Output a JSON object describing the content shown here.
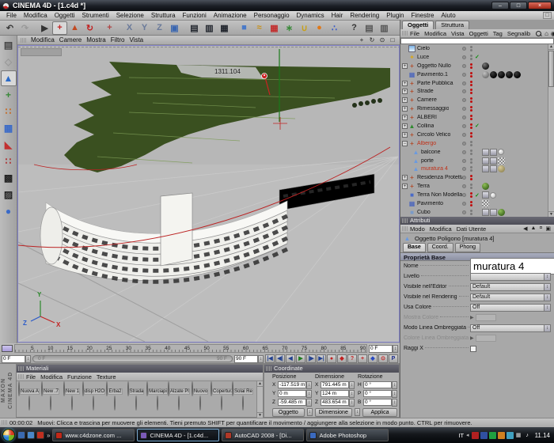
{
  "window": {
    "title": "CINEMA 4D - [1.c4d *]",
    "minimize": "–",
    "restore": "□",
    "close": "×",
    "mdi_restore": "□"
  },
  "menu_bar": {
    "items": [
      "File",
      "Modifica",
      "Oggetti",
      "Strumenti",
      "Selezione",
      "Struttura",
      "Funzioni",
      "Animazione",
      "Personaggio",
      "Dynamics",
      "Hair",
      "Rendering",
      "Plugin",
      "Finestre",
      "Aiuto"
    ]
  },
  "toolbar": {
    "icons": [
      {
        "name": "undo-icon",
        "g": "↶",
        "c": "#3a3a3a"
      },
      {
        "name": "redo-icon",
        "g": "↷",
        "c": "#9a9a9a"
      },
      {
        "name": "live-selection-icon",
        "g": "▶",
        "c": "#333333",
        "cls": "gap"
      },
      {
        "name": "move-tool-icon",
        "g": "+",
        "c": "#c22222",
        "cls": "active"
      },
      {
        "name": "scale-tool-icon",
        "g": "▲",
        "c": "#c24a22"
      },
      {
        "name": "rotate-tool-icon",
        "g": "↻",
        "c": "#c22222"
      },
      {
        "name": "last-tool-icon",
        "g": "+",
        "c": "#b04444",
        "cls": "gap"
      },
      {
        "name": "lock-x-axis-icon",
        "g": "X",
        "c": "#6a7a9a",
        "cls": "gap"
      },
      {
        "name": "lock-y-axis-icon",
        "g": "Y",
        "c": "#6a7a9a"
      },
      {
        "name": "lock-z-axis-icon",
        "g": "Z",
        "c": "#6a7a9a"
      },
      {
        "name": "coordinate-system-icon",
        "g": "▣",
        "c": "#3a66b0"
      },
      {
        "name": "render-view-icon",
        "g": "▤",
        "c": "#22262e",
        "cls": "gap"
      },
      {
        "name": "render-region-icon",
        "g": "▥",
        "c": "#22262e"
      },
      {
        "name": "render-settings-icon",
        "g": "▦",
        "c": "#22262e"
      },
      {
        "name": "add-cube-icon",
        "g": "■",
        "c": "#4a7ac8",
        "cls": "gap"
      },
      {
        "name": "add-spline-icon",
        "g": "≈",
        "c": "#c89018"
      },
      {
        "name": "add-deformer-icon",
        "g": "▦",
        "c": "#c23030"
      },
      {
        "name": "add-array-icon",
        "g": "∗",
        "c": "#3a8a3a"
      },
      {
        "name": "add-boole-icon",
        "g": "∪",
        "c": "#c8a018"
      },
      {
        "name": "add-sphere-icon",
        "g": "●",
        "c": "#e07818"
      },
      {
        "name": "add-particles-icon",
        "g": "∴",
        "c": "#3a5ac8"
      },
      {
        "name": "help-cursor-icon",
        "g": "?",
        "c": "#333333",
        "cls": "gap"
      },
      {
        "name": "display-layout-icon",
        "g": "▤",
        "c": "#555555"
      },
      {
        "name": "display-layout-2-icon",
        "g": "▥",
        "c": "#555555"
      }
    ]
  },
  "left_toolbar": {
    "icons": [
      {
        "name": "layout-switch-icon",
        "g": "▤",
        "c": "#444444"
      },
      {
        "name": "convert-object-icon",
        "g": "◇",
        "c": "#999999"
      },
      {
        "name": "model-mode-icon",
        "g": "▲",
        "c": "#2a6ac8",
        "cls": "active"
      },
      {
        "name": "object-axis-mode-icon",
        "g": "+",
        "c": "#3a8a3a"
      },
      {
        "name": "point-mode-icon",
        "g": "∷",
        "c": "#c86820"
      },
      {
        "name": "edge-mode-icon",
        "g": "▦",
        "c": "#3a6ac8"
      },
      {
        "name": "polygon-mode-icon",
        "g": "◣",
        "c": "#c23030"
      },
      {
        "name": "animation-mode-icon",
        "g": "∷",
        "c": "#b03030"
      },
      {
        "name": "texture-mode-icon",
        "g": "▩",
        "c": "#222222"
      },
      {
        "name": "texture-axis-mode-icon",
        "g": "▨",
        "c": "#222222"
      },
      {
        "name": "object-mode-icon",
        "g": "●",
        "c": "#3a6ac8"
      }
    ]
  },
  "viewport": {
    "menu": [
      "Modifica",
      "Camere",
      "Mostra",
      "Filtro",
      "Vista"
    ],
    "nav": [
      {
        "name": "pan-view-icon",
        "g": "+"
      },
      {
        "name": "rotate-view-icon",
        "g": "↻"
      },
      {
        "name": "zoom-view-icon",
        "g": "⊙"
      },
      {
        "name": "toggle-view-icon",
        "g": "□"
      }
    ],
    "measure_label": "1311.104",
    "axis": {
      "x": "X",
      "y": "Y",
      "z": "Z"
    }
  },
  "timeline": {
    "ticks": [
      "5",
      "10",
      "15",
      "20",
      "25",
      "30",
      "35",
      "40",
      "45",
      "50",
      "55",
      "60",
      "65",
      "70",
      "75",
      "80",
      "85",
      "90"
    ],
    "top_right_field": "0 F",
    "frame_field": "0 F",
    "range_start_label": "0 F",
    "range_end_label": "90 F",
    "range_end_field": "90 F",
    "transport": [
      {
        "name": "goto-start-button",
        "g": "|◀",
        "c": "#23418f"
      },
      {
        "name": "previous-frame-button",
        "g": "◀|",
        "c": "#23418f"
      },
      {
        "name": "play-backward-button",
        "g": "◀",
        "c": "#23418f"
      },
      {
        "name": "play-button",
        "g": "▶",
        "c": "#1f7a1f"
      },
      {
        "name": "next-frame-button",
        "g": "|▶",
        "c": "#23418f"
      },
      {
        "name": "goto-end-button",
        "g": "▶|",
        "c": "#23418f"
      },
      {
        "name": "record-button",
        "g": "●",
        "c": "#c22020"
      },
      {
        "name": "record-key-button",
        "g": "◆",
        "c": "#c22020"
      },
      {
        "name": "autokey-button",
        "g": "?",
        "c": "#c22020"
      },
      {
        "name": "add-key-button",
        "g": "+",
        "c": "#c22020"
      },
      {
        "name": "key-tool-button",
        "g": "◆",
        "c": "#2a4ac0"
      },
      {
        "name": "time-settings-button",
        "g": "⊙",
        "c": "#c22020"
      },
      {
        "name": "powerslider-button",
        "g": "P",
        "c": "#1a2a8a"
      }
    ]
  },
  "materials": {
    "title": "Materiali",
    "menu": [
      "File",
      "Modifica",
      "Funzione",
      "Texture"
    ],
    "row1": [
      {
        "name": "Nuova A",
        "bg": "radial-gradient(circle at 35% 30%,#d8ecf8,#5a8cc0 45%,#2f4f33 85%)"
      },
      {
        "name": "New .7",
        "bg": "radial-gradient(circle at 35% 30%,#3a3a3a,#000 70%)"
      },
      {
        "name": "New 1",
        "bg": "radial-gradient(circle at 35% 30%,#2e2e2e,#000 70%)"
      },
      {
        "name": "disp H2O",
        "bg": "radial-gradient(circle at 35% 30%,#303038,#000 70%)"
      },
      {
        "name": "Erba2",
        "bg": "radial-gradient(circle at 35% 30%,#9cc455,#43611c 75%)"
      },
      {
        "name": "Strada",
        "bg": "radial-gradient(circle at 35% 30%,#b0b0b0,#5e5e5e 75%)"
      },
      {
        "name": "Marciapi",
        "bg": "radial-gradient(circle at 35% 30%,#b2b4a4,#686a5c 75%)"
      },
      {
        "name": "Alzate Pl",
        "bg": "radial-gradient(circle at 35% 30%,#dededa,#96968e 75%)"
      },
      {
        "name": "Nuovo",
        "bg": "radial-gradient(circle at 35% 30%,#ececea,#aaaaa4 75%)"
      },
      {
        "name": "Copertur.",
        "bg": "repeating-linear-gradient(135deg,#c2c2ca 0 2px,#7e7e88 2px 4px)"
      },
      {
        "name": "Solai Re",
        "bg": "radial-gradient(circle at 35% 30%,#d6d6d2,#8e8e86 75%)"
      }
    ],
    "row2": [
      {
        "bg": "repeating-linear-gradient(45deg,#9a9a9a 0 2px,#555 2px 4px)"
      },
      {
        "bg": "radial-gradient(circle at 35% 30%,#fff,#9ab0c0 50%,#5a6a78)"
      },
      {
        "bg": "radial-gradient(circle at 35% 30%,#e2d27a,#a08a22 75%)"
      },
      {
        "bg": "radial-gradient(circle at 35% 30%,#b0a878,#66663e 75%)"
      },
      {
        "bg": "repeating-linear-gradient(135deg,#aaa 0 2px,#777 2px 4px)"
      },
      {
        "bg": "radial-gradient(circle at 35% 30%,#6a4a32,#2c1a10 75%)"
      },
      {
        "bg": "radial-gradient(circle at 35% 30%,#8a9a50,#47561f 75%)"
      },
      {
        "bg": "radial-gradient(circle at 35% 30%,#3a3a3a,#0a0a0a 75%)"
      },
      {
        "bg": "radial-gradient(circle at 35% 30%,#9ac060,#4a7a20 75%)"
      },
      {
        "bg": "radial-gradient(circle at 35% 30%,#b8b8b8,#666 75%)"
      },
      {
        "bg": "radial-gradient(circle at 35% 30%,#e0e0da,#9a9a92 75%)"
      }
    ]
  },
  "coordinate": {
    "title": "Coordinate",
    "headers": [
      "Posizione",
      "Dimensione",
      "Rotazione"
    ],
    "rows": [
      {
        "a": "X",
        "av": "-117.519 m",
        "b": "X",
        "bv": "791.445 m",
        "c": "H",
        "cv": "0 °"
      },
      {
        "a": "Y",
        "av": "0 m",
        "b": "Y",
        "bv": "124 m",
        "c": "P",
        "cv": "0 °"
      },
      {
        "a": "Z",
        "av": "-59.485 m",
        "b": "Z",
        "bv": "483.654 m",
        "c": "B",
        "cv": "0 °"
      }
    ],
    "buttons": {
      "left": "Oggetto",
      "middle": "Dimensione",
      "apply": "Applica"
    }
  },
  "om": {
    "tabs": [
      "Oggetti",
      "Struttura"
    ],
    "menu": [
      "File",
      "Modifica",
      "Vista",
      "Oggetti",
      "Tag",
      "Segnalib"
    ],
    "items": [
      {
        "label": "Cielo",
        "icon": "sky",
        "dots": "gray"
      },
      {
        "label": "Luce",
        "icon": "light",
        "dots": "gray",
        "check": true
      },
      {
        "label": "Oggetto Nullo",
        "icon": "null",
        "dots": "red",
        "expand": "+",
        "materials": [
          "dark"
        ]
      },
      {
        "label": "Pavimento.1",
        "icon": "floor",
        "dots": "red",
        "materials": [
          "gray",
          "black",
          "black",
          "black",
          "black"
        ]
      },
      {
        "label": "Parte Pubblica",
        "icon": "null",
        "dots": "red",
        "expand": "+"
      },
      {
        "label": "Strade",
        "icon": "null",
        "dots": "red",
        "expand": "+"
      },
      {
        "label": "Camere",
        "icon": "null",
        "dots": "red",
        "expand": "+"
      },
      {
        "label": "Rimessaggio",
        "icon": "null",
        "dots": "red",
        "expand": "+"
      },
      {
        "label": "ALBERI",
        "icon": "null",
        "dots": "red",
        "expand": "+"
      },
      {
        "label": "Collina",
        "icon": "landscape",
        "dots": "red",
        "expand": "+",
        "check": true
      },
      {
        "label": "Circolo Velico",
        "icon": "null",
        "dots": "red",
        "expand": "+"
      },
      {
        "label": "Albergo",
        "icon": "null",
        "dots": "gray",
        "expand": "-",
        "selected": true
      },
      {
        "label": "balcone",
        "icon": "polygon",
        "dots": "gray",
        "child": true,
        "tags": true,
        "materials": [
          "white"
        ]
      },
      {
        "label": "porte",
        "icon": "polygon",
        "dots": "gray",
        "child": true,
        "tags": true,
        "materials": [
          "checker"
        ]
      },
      {
        "label": "muratura 4",
        "icon": "polygon",
        "dots": "gray",
        "child": true,
        "selected": true,
        "tags": true,
        "materials": [
          "tan"
        ]
      },
      {
        "label": "Residenza Protetta",
        "icon": "null",
        "dots": "red",
        "expand": "+"
      },
      {
        "label": "Terra",
        "icon": "null",
        "dots": "gray",
        "expand": "+",
        "materials": [
          "green"
        ]
      },
      {
        "label": "Terra Non Modellata",
        "icon": "plane",
        "dots": "red",
        "check": true,
        "tags": true,
        "materials": [
          "white"
        ]
      },
      {
        "label": "Pavimento",
        "icon": "floor",
        "dots": "red",
        "materials": [
          "checker"
        ]
      },
      {
        "label": "Cubo",
        "icon": "cube",
        "dots": "gray",
        "tags": true,
        "materials": [
          "green"
        ]
      }
    ]
  },
  "attr": {
    "title": "Attributi",
    "menu": [
      "Modo",
      "Modifica",
      "Dati Utente"
    ],
    "object_label": "Oggetto Poligono [muratura 4]",
    "tabs": [
      "Base",
      "Coord.",
      "Phong"
    ],
    "section": "Proprietà Base",
    "fields": [
      {
        "label": "Nome",
        "value": "muratura 4"
      },
      {
        "label": "Livello",
        "value": ""
      },
      {
        "label": "Visibile nell'Editor",
        "value": "Default"
      },
      {
        "label": "Visibile nel Rendering",
        "value": "Default"
      },
      {
        "label": "Usa Colore",
        "value": "Off"
      },
      {
        "label": "Mostra Colore",
        "value": ""
      },
      {
        "label": "Modo Linea Ombreggiata",
        "value": "Off"
      },
      {
        "label": "Colore Linea Ombreggiata",
        "value": ""
      },
      {
        "label": "Raggi X",
        "value": ""
      }
    ]
  },
  "status_bar": {
    "time": "00:00:02",
    "message": "Muovi: Clicca e trascina per muovere gli elementi. Tieni premuto SHIFT per quantificare il movimento / aggiungere alla selezione in modo punto. CTRL per rimuovere."
  },
  "branding": {
    "line1": "MAXON",
    "line2": "CINEMA 4D"
  },
  "taskbar": {
    "quick_launch": [
      {
        "name": "show-desktop-icon",
        "bg": "#3a6ab0"
      },
      {
        "name": "switch-windows-icon",
        "bg": "#4a88c8"
      },
      {
        "name": "browser-icon",
        "bg": "#c03020"
      }
    ],
    "overflow_label": "»",
    "tasks": [
      {
        "label": "www.c4dzone.com ...",
        "ibg": "#c02818"
      },
      {
        "label": "CINEMA 4D - [1.c4d...",
        "ibg": "#7a5ab8",
        "cls": "active"
      },
      {
        "label": "AutoCAD 2008 - [Di...",
        "ibg": "#b03828"
      },
      {
        "label": "Adobe Photoshop",
        "ibg": "#3a6ac0"
      }
    ],
    "language": "IT",
    "tray_icons": [
      {
        "name": "tray-app-1-icon",
        "bg": "#b02020"
      },
      {
        "name": "tray-app-2-icon",
        "bg": "#3050a0"
      },
      {
        "name": "tray-app-3-icon",
        "bg": "#20a040"
      },
      {
        "name": "tray-app-4-icon",
        "bg": "#d08020"
      },
      {
        "name": "tray-app-5-icon",
        "bg": "#40a0c0"
      },
      {
        "name": "network-icon",
        "g": "▦",
        "c": "#dddddd"
      },
      {
        "name": "volume-icon",
        "g": "♪",
        "c": "#ffffff"
      }
    ],
    "clock": "11.14"
  },
  "colors": {
    "selection_red": "#c03018",
    "viewport_border": "#8080c8",
    "terrain_green": "#3a5020",
    "spline_red": "#bb2222",
    "axis_green": "#1a7a1a"
  }
}
